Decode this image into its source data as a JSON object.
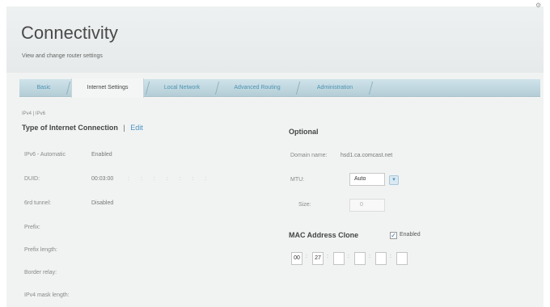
{
  "header": {
    "title": "Connectivity",
    "subtitle": "View and change router settings"
  },
  "tabs": [
    {
      "label": "Basic",
      "active": false
    },
    {
      "label": "Internet Settings",
      "active": true
    },
    {
      "label": "Local Network",
      "active": false
    },
    {
      "label": "Advanced Routing",
      "active": false
    },
    {
      "label": "Administration",
      "active": false
    }
  ],
  "breadcrumb": "IPv4 | IPv6",
  "internet": {
    "section_title": "Type of Internet Connection",
    "separator": "|",
    "edit_label": "Edit",
    "rows": [
      {
        "label": "IPv6 - Automatic",
        "value": "Enabled"
      },
      {
        "label": "DUID:",
        "value": "00:03:00"
      },
      {
        "label": "6rd tunnel:",
        "value": "Disabled"
      },
      {
        "label": "Prefix:",
        "value": ""
      },
      {
        "label": "Prefix length:",
        "value": ""
      },
      {
        "label": "Border relay:",
        "value": ""
      },
      {
        "label": "IPv4 mask length:",
        "value": ""
      }
    ],
    "duid_dots": ": : : : : : :"
  },
  "optional": {
    "section_title": "Optional",
    "domain_label": "Domain name:",
    "domain_value": "hsd1.ca.comcast.net",
    "mtu_label": "MTU:",
    "mtu_value": "Auto",
    "size_label": "Size:",
    "size_value": "0"
  },
  "mac_clone": {
    "title": "MAC Address Clone",
    "enabled_label": "Enabled",
    "checked": true,
    "octets": [
      "00",
      "27",
      "",
      "",
      "",
      ""
    ]
  },
  "colors": {
    "accent": "#4a90c2",
    "tab_bar": "#c2d9e1"
  }
}
